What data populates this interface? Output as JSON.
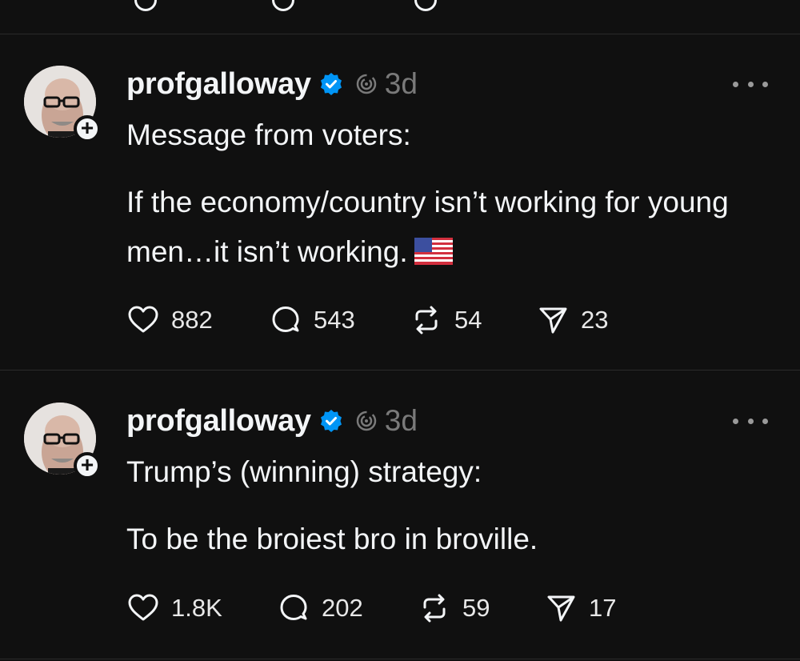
{
  "posts": [
    {
      "username": "profgalloway",
      "time": "3d",
      "lines": [
        "Message from voters:",
        "If the economy/country isn’t working for young men…it isn’t working."
      ],
      "flag_emoji": "us-flag",
      "likes": "882",
      "replies": "543",
      "reposts": "54",
      "shares": "23"
    },
    {
      "username": "profgalloway",
      "time": "3d",
      "lines": [
        "Trump’s (winning) strategy:",
        "To be the broiest bro in broville."
      ],
      "likes": "1.8K",
      "replies": "202",
      "reposts": "59",
      "shares": "17"
    }
  ],
  "icons": {
    "verified": "verified-badge-icon",
    "threads": "threads-spiral-icon",
    "more": "more-options-icon",
    "like": "heart-icon",
    "reply": "comment-bubble-icon",
    "repost": "repost-icon",
    "share": "send-triangle-icon",
    "follow": "plus-icon"
  },
  "colors": {
    "background": "#101010",
    "text": "#f3f5f7",
    "muted": "#7a7a7a",
    "verified": "#0095f6",
    "divider": "#2a2a2a"
  }
}
